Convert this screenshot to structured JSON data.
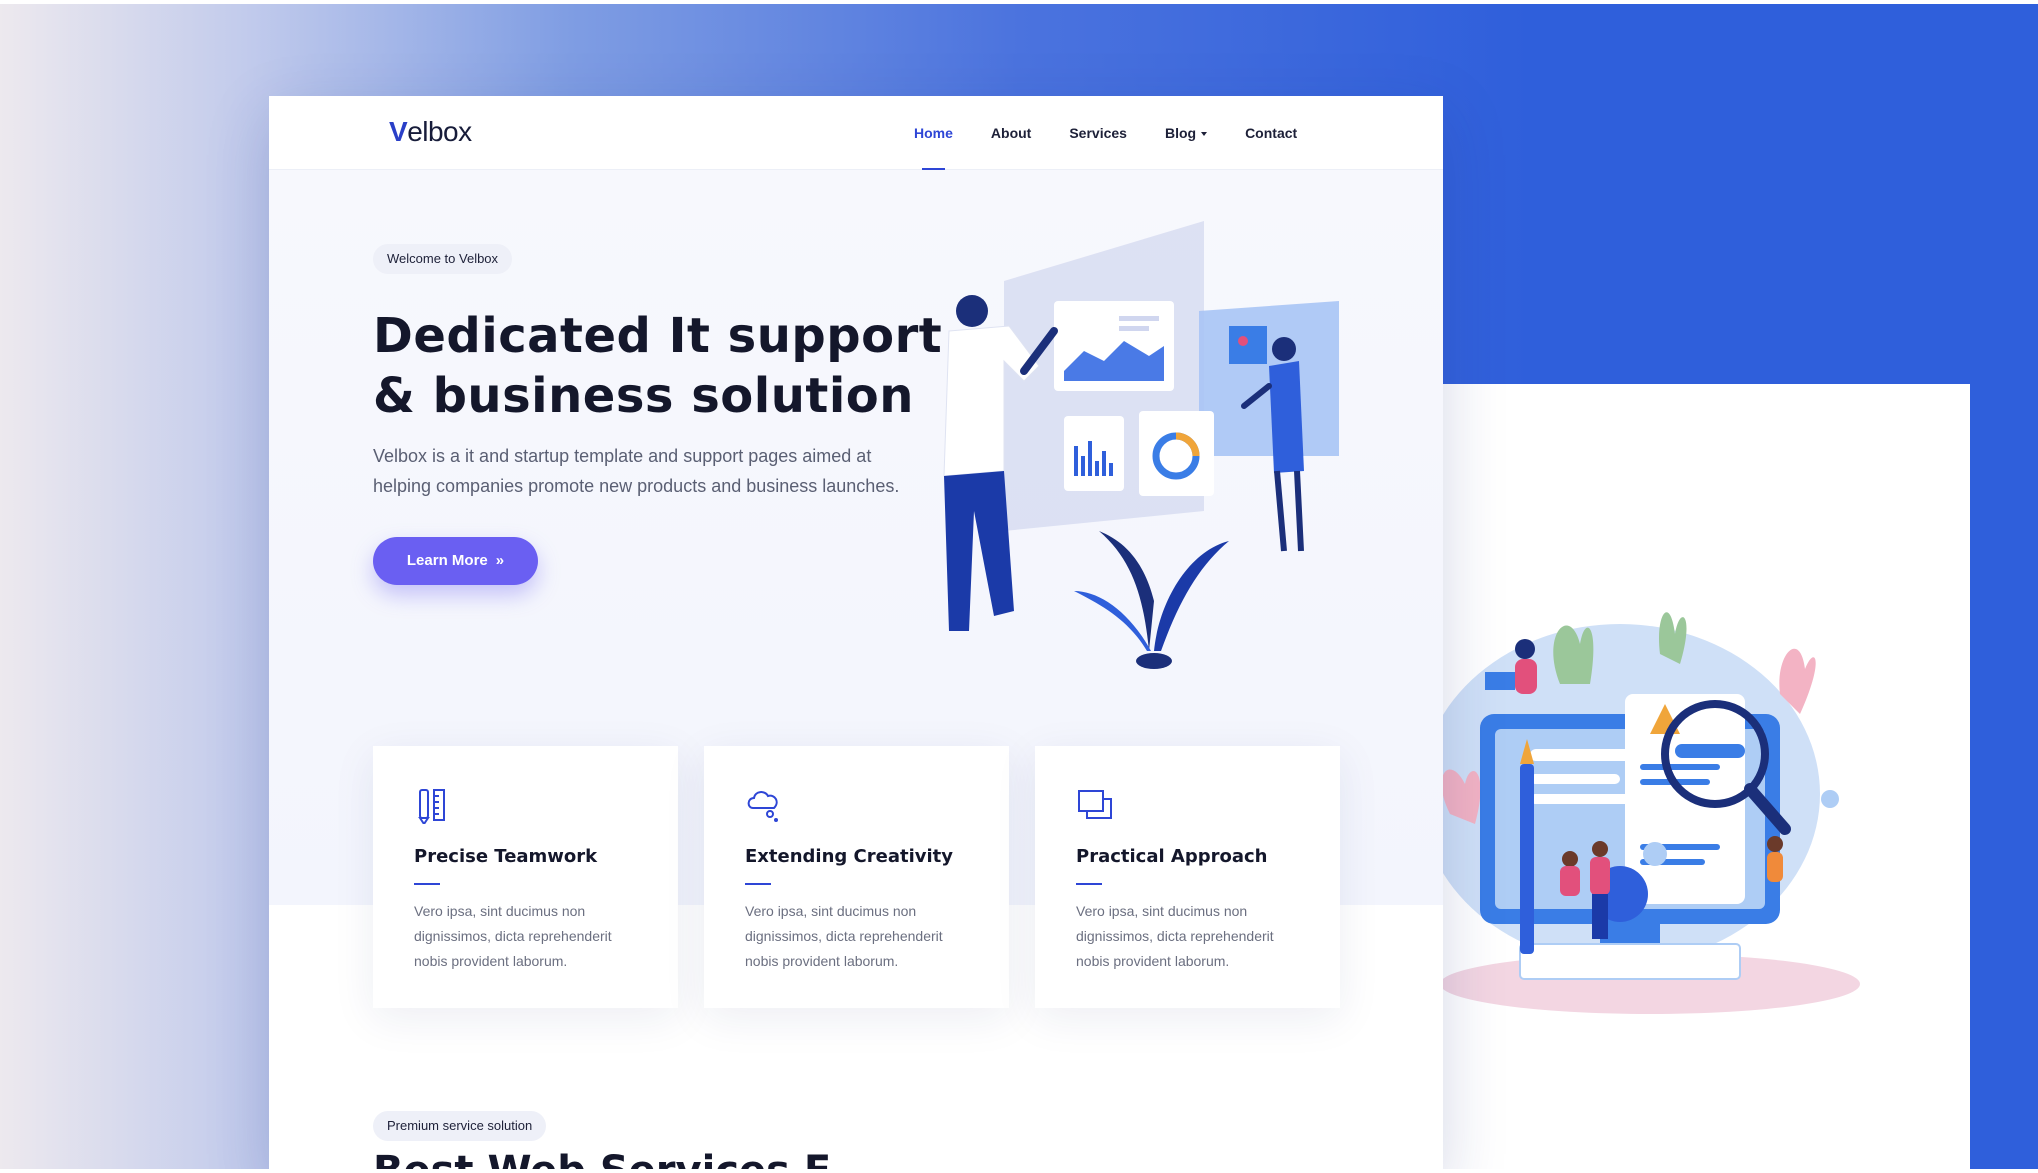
{
  "brand": {
    "logo_v": "V",
    "logo_rest": "elbox"
  },
  "nav": {
    "items": [
      {
        "label": "Home"
      },
      {
        "label": "About"
      },
      {
        "label": "Services"
      },
      {
        "label": "Blog"
      },
      {
        "label": "Contact"
      }
    ]
  },
  "hero": {
    "badge": "Welcome to Velbox",
    "title_line1": "Dedicated It support",
    "title_line2": "& business solution",
    "description": "Velbox is a it and startup template and support pages aimed at helping companies promote new products and business launches.",
    "button_label": "Learn More",
    "button_icon": "»"
  },
  "features": [
    {
      "icon": "ruler-pencil-icon",
      "title": "Precise Teamwork",
      "text": "Vero ipsa, sint ducimus non dignissimos, dicta reprehenderit nobis provident laborum."
    },
    {
      "icon": "cloud-idea-icon",
      "title": "Extending Creativity",
      "text": "Vero ipsa, sint ducimus non dignissimos, dicta reprehenderit nobis provident laborum."
    },
    {
      "icon": "layers-icon",
      "title": "Practical Approach",
      "text": "Vero ipsa, sint ducimus non dignissimos, dicta reprehenderit nobis provident laborum."
    }
  ],
  "section2": {
    "badge": "Premium service solution",
    "title_partial": "Best Web Services F"
  },
  "colors": {
    "accent": "#2e46d6",
    "button": "#6a5ff2",
    "background_blue": "#2f5fdb"
  }
}
